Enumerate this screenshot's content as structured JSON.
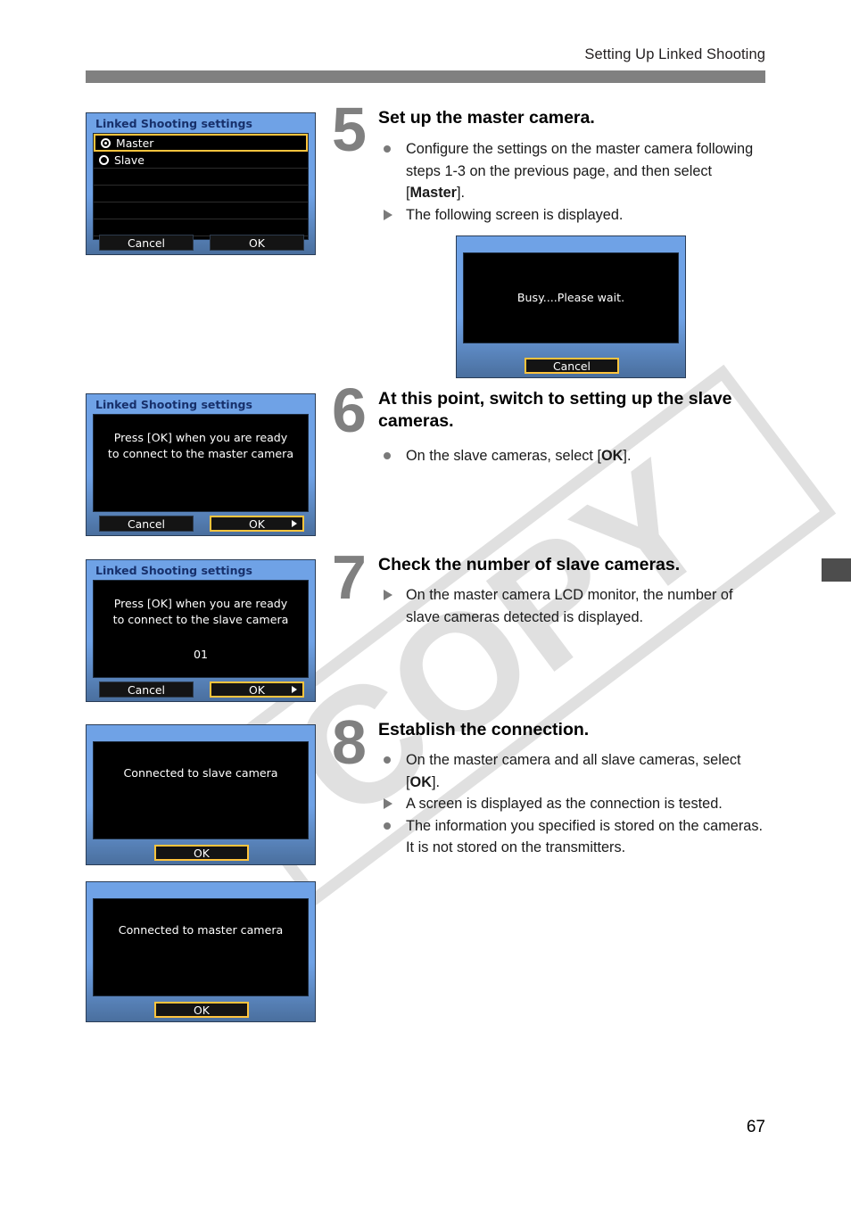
{
  "page": {
    "running_head": "Setting Up Linked Shooting",
    "folio": "67",
    "watermark": "COPY",
    "rule_color": "#808080",
    "tab_color": "#4d4d4d"
  },
  "screens": {
    "step5_settings": {
      "title": "Linked Shooting settings",
      "options": [
        {
          "label": "Master",
          "selected": true
        },
        {
          "label": "Slave",
          "selected": false
        }
      ],
      "buttons": {
        "cancel": "Cancel",
        "ok": "OK"
      }
    },
    "busy": {
      "message": "Busy....Please wait.",
      "buttons": {
        "cancel": "Cancel"
      }
    },
    "step6_settings": {
      "title": "Linked Shooting settings",
      "message": "Press [OK] when you are ready\nto connect to the master camera",
      "buttons": {
        "cancel": "Cancel",
        "ok": "OK"
      }
    },
    "step7_settings": {
      "title": "Linked Shooting settings",
      "message": "Press [OK] when you are ready\nto connect to the slave camera",
      "count": "01",
      "buttons": {
        "cancel": "Cancel",
        "ok": "OK"
      }
    },
    "connected_slave": {
      "message": "Connected to slave camera",
      "buttons": {
        "ok": "OK"
      }
    },
    "connected_master": {
      "message": "Connected to master camera",
      "buttons": {
        "ok": "OK"
      }
    }
  },
  "steps": [
    {
      "number": "5",
      "title": "Set up the master camera.",
      "items": [
        {
          "marker": "dot",
          "text_html": "Configure the settings on the master camera following steps 1-3 on the previous page, and then select [<b class=\"inl\">Master</b>]."
        },
        {
          "marker": "tri",
          "text_html": "The following screen is displayed."
        }
      ]
    },
    {
      "number": "6",
      "title": "At this point, switch to setting up the slave cameras.",
      "items": [
        {
          "marker": "dot",
          "text_html": "On the slave cameras, select [<b class=\"inl\">OK</b>]."
        }
      ]
    },
    {
      "number": "7",
      "title": "Check the number of slave cameras.",
      "items": [
        {
          "marker": "tri",
          "text_html": "On the master camera LCD monitor, the number of slave cameras detected is displayed."
        }
      ]
    },
    {
      "number": "8",
      "title": "Establish the connection.",
      "items": [
        {
          "marker": "dot",
          "text_html": "On the master camera and all slave cameras, select [<b class=\"inl\">OK</b>]."
        },
        {
          "marker": "tri",
          "text_html": "A screen is displayed as the connection is tested."
        },
        {
          "marker": "dot",
          "text_html": "The information you specified is stored on the cameras. It is not stored on the transmitters."
        }
      ]
    }
  ]
}
